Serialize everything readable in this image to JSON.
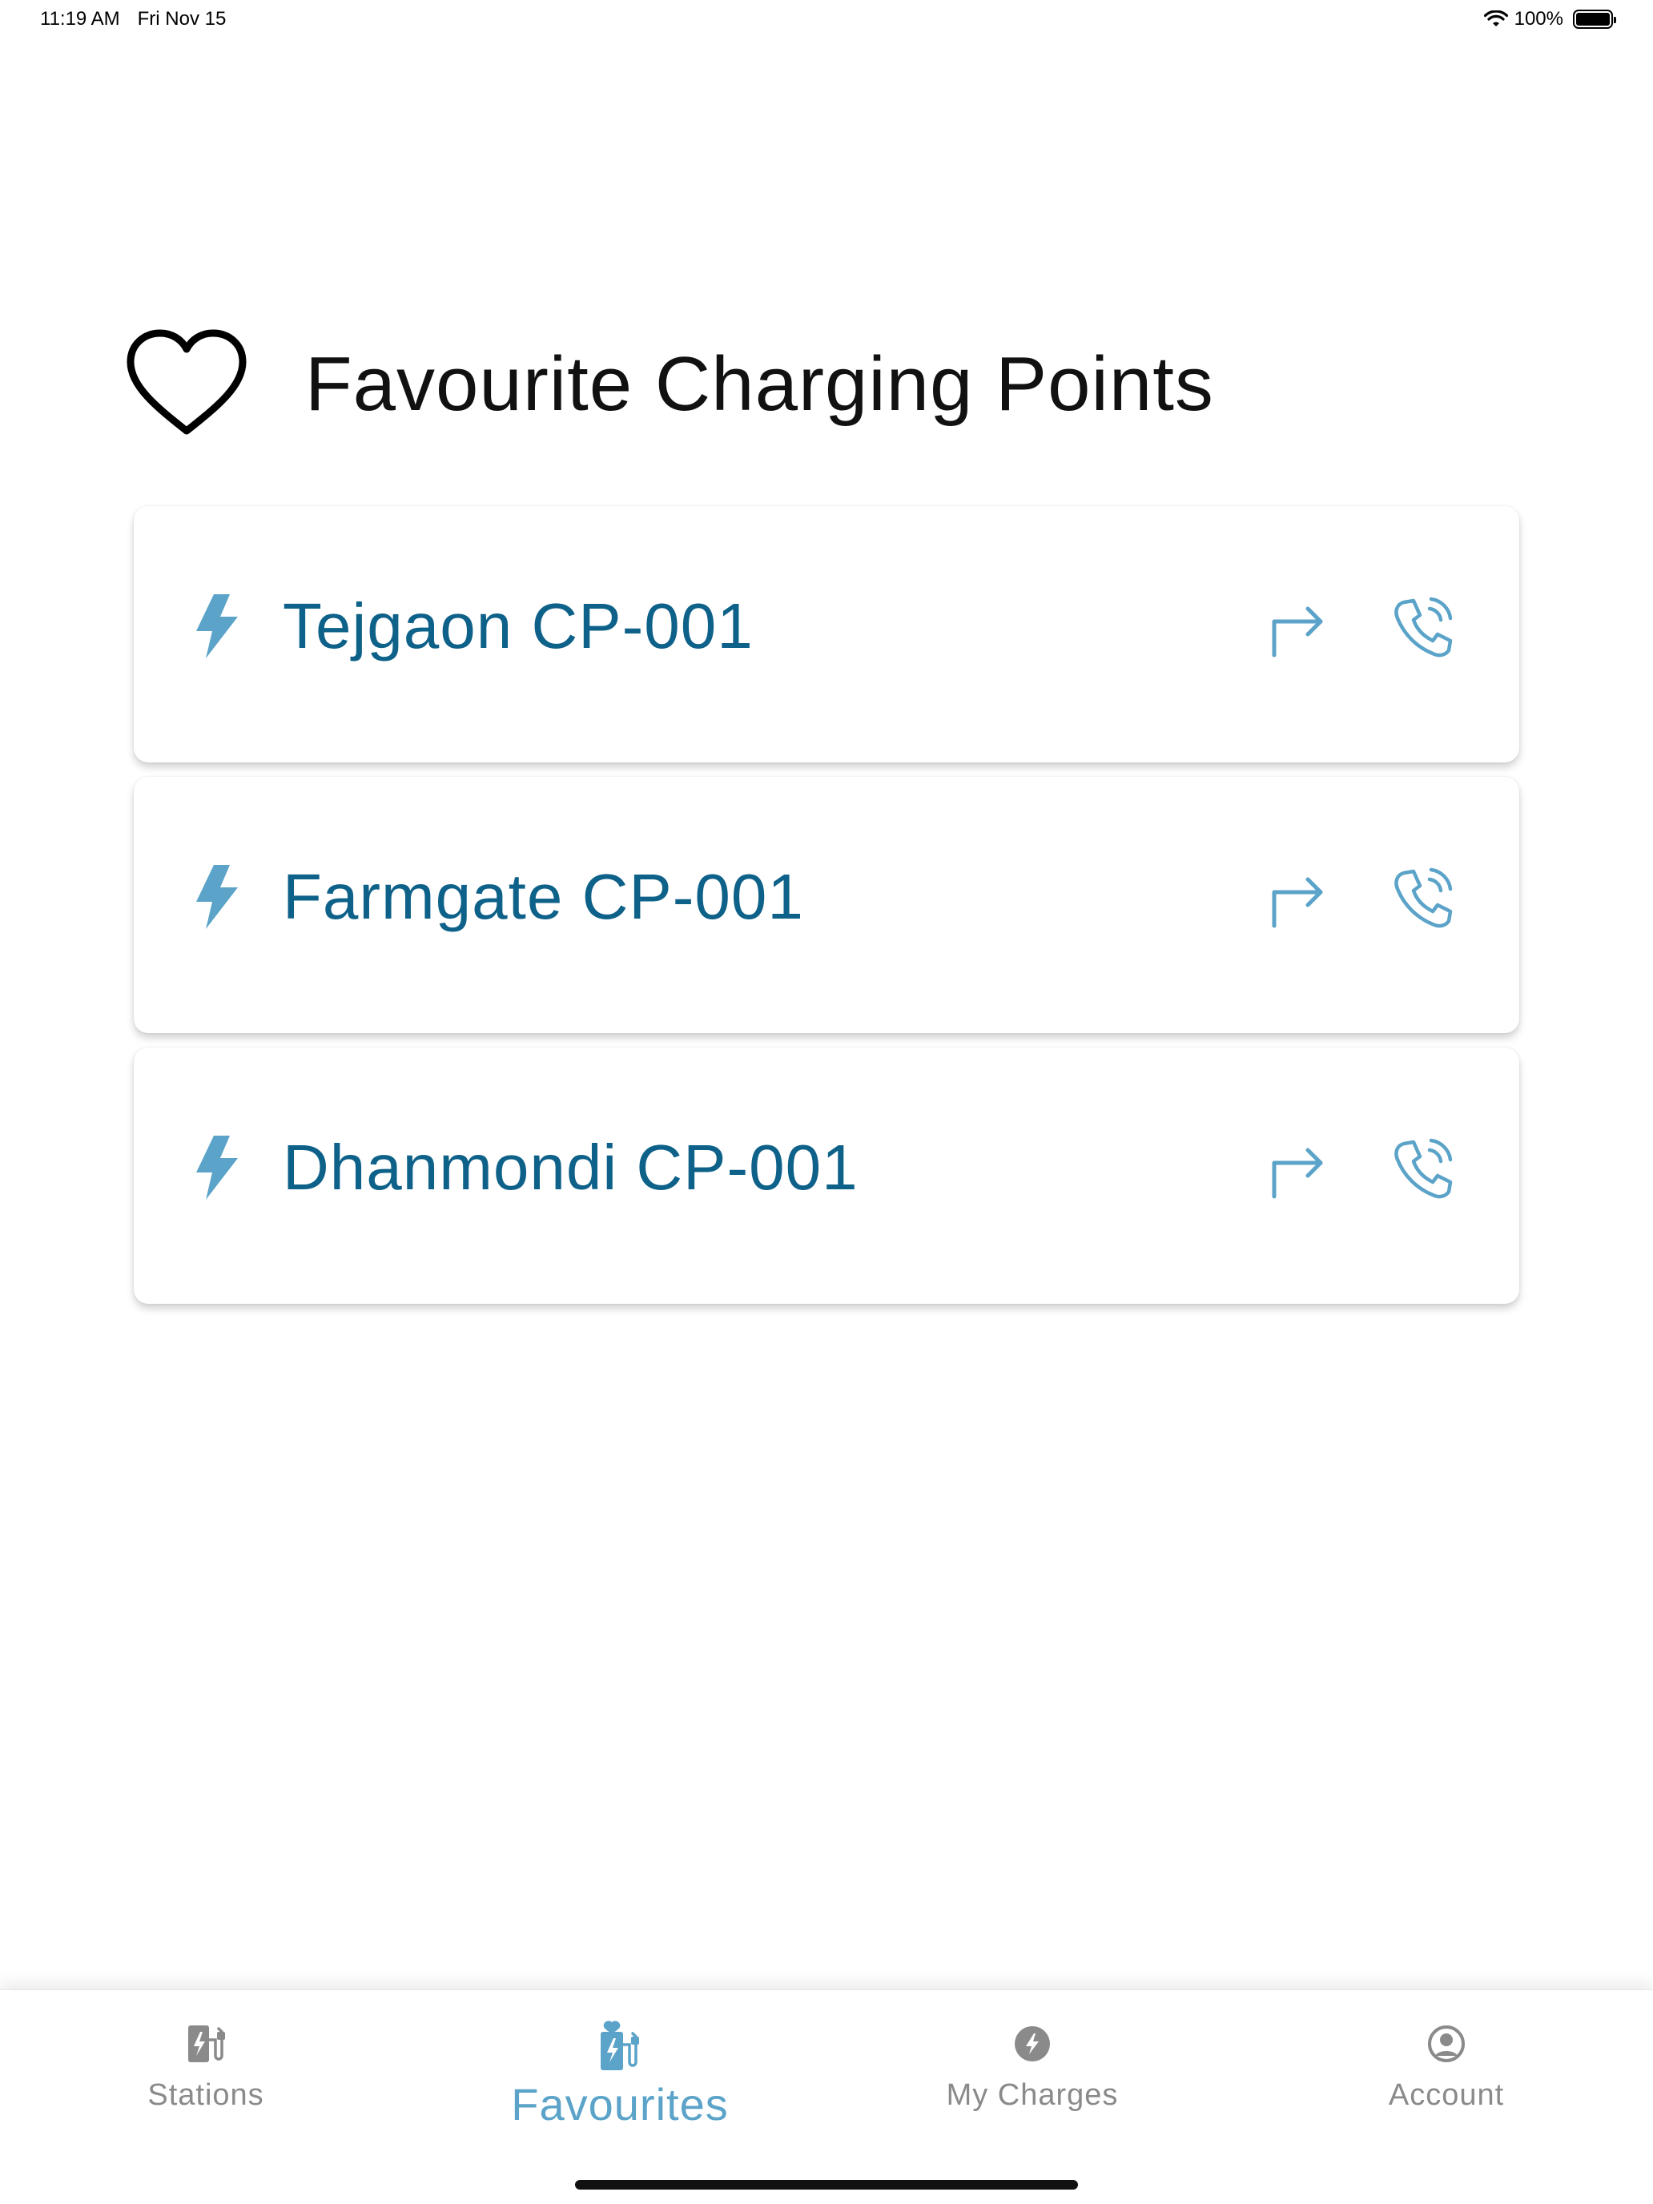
{
  "status_bar": {
    "time": "11:19 AM",
    "date": "Fri Nov 15",
    "battery": "100%"
  },
  "header": {
    "title": "Favourite Charging Points",
    "icon": "heart-icon"
  },
  "favourites": [
    {
      "name": "Tejgaon CP-001"
    },
    {
      "name": "Farmgate CP-001"
    },
    {
      "name": "Dhanmondi CP-001"
    }
  ],
  "tabs": [
    {
      "label": "Stations",
      "icon": "charging-station-icon",
      "active": false
    },
    {
      "label": "Favourites",
      "icon": "favourite-station-icon",
      "active": true
    },
    {
      "label": "My Charges",
      "icon": "bolt-circle-icon",
      "active": false
    },
    {
      "label": "Account",
      "icon": "account-circle-icon",
      "active": false
    }
  ],
  "colors": {
    "accent": "#5ba3c8",
    "primary_text": "#0e6189",
    "inactive": "#8a8a8a"
  }
}
